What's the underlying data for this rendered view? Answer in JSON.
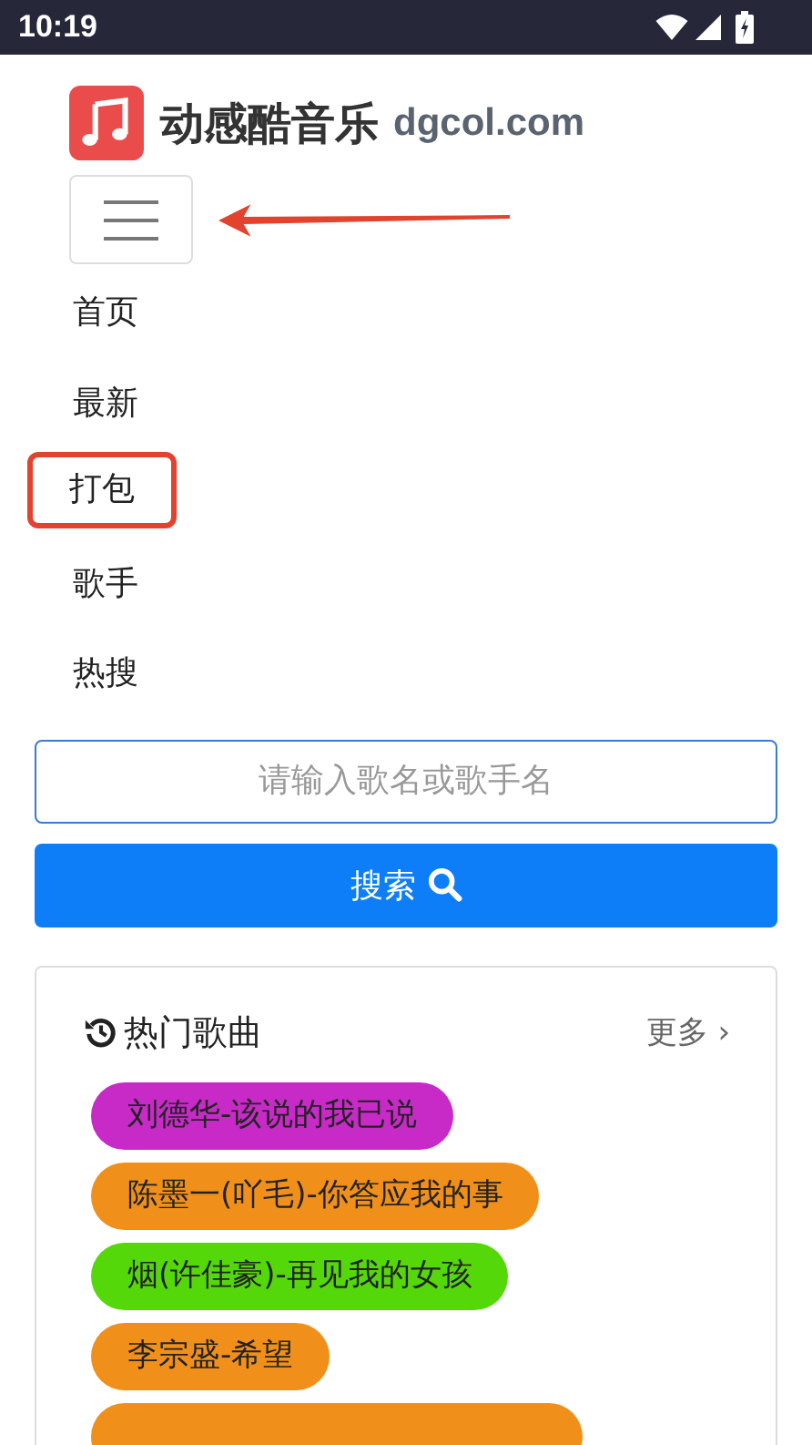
{
  "status_bar": {
    "time": "10:19"
  },
  "header": {
    "site_name": "动感酷音乐",
    "domain": "dgcol.com"
  },
  "menu_button": {
    "pointer_arrow": true
  },
  "nav": [
    {
      "label": "首页",
      "highlighted": false
    },
    {
      "label": "最新",
      "highlighted": false
    },
    {
      "label": "打包",
      "highlighted": true
    },
    {
      "label": "歌手",
      "highlighted": false
    },
    {
      "label": "热搜",
      "highlighted": false
    }
  ],
  "search": {
    "placeholder": "请输入歌名或歌手名",
    "button": "搜索"
  },
  "hot_songs": {
    "title": "热门歌曲",
    "more": "更多",
    "more_arrow": "›",
    "songs": [
      {
        "label": "刘德华-该说的我已说",
        "color": "#c82ac8"
      },
      {
        "label": "陈墨一(吖毛)-你答应我的事",
        "color": "#f0901a"
      },
      {
        "label": "烟(许佳豪)-再见我的女孩",
        "color": "#55d80a"
      },
      {
        "label": "李宗盛-希望",
        "color": "#f0901a"
      },
      {
        "color": "#f0901a"
      }
    ]
  }
}
